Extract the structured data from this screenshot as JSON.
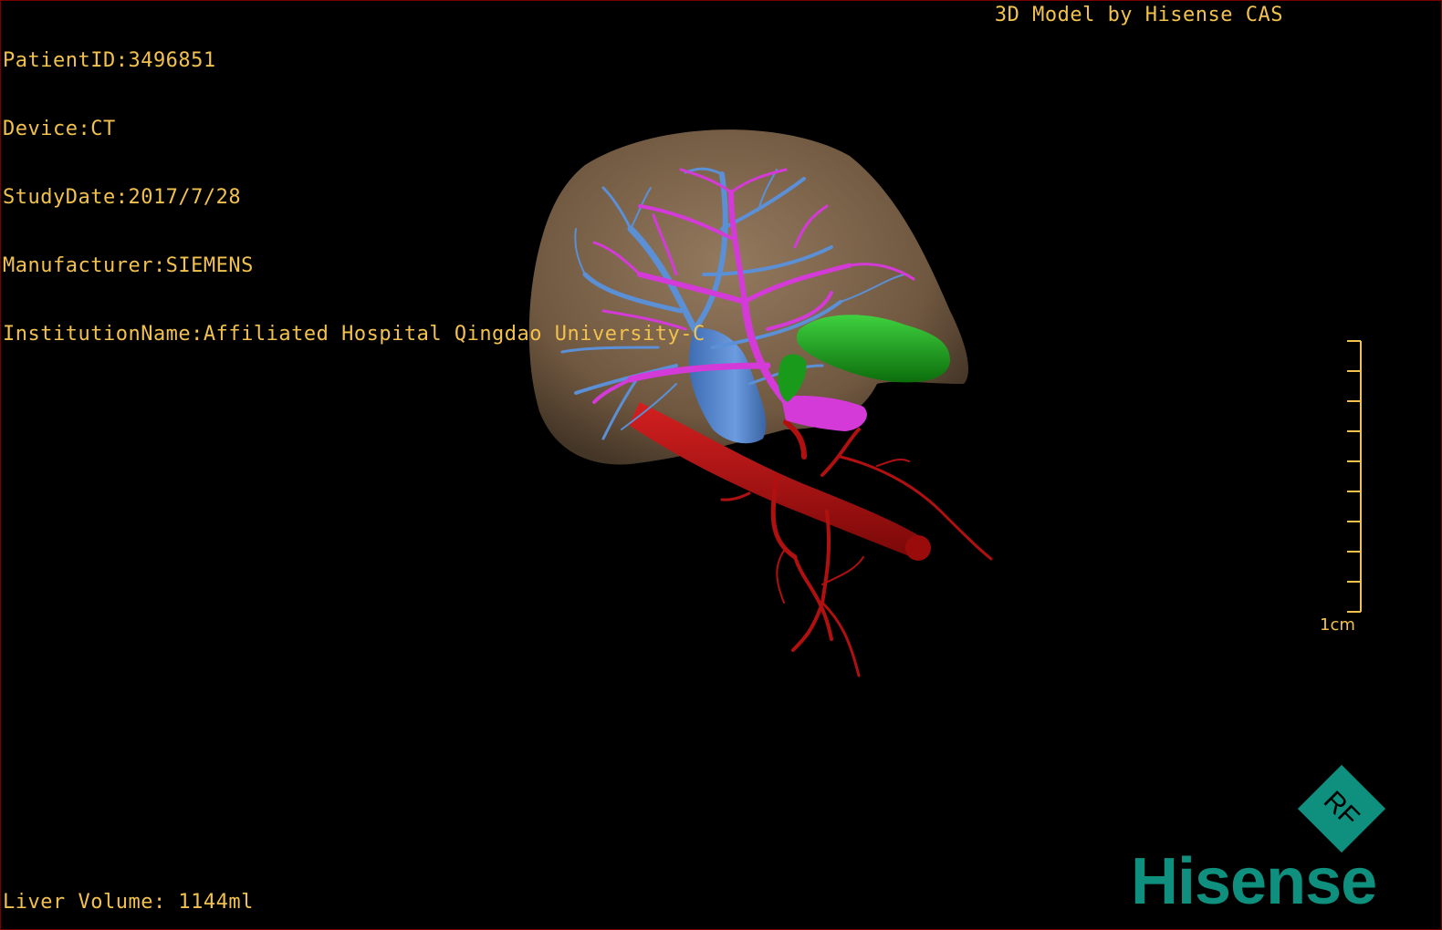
{
  "header": {
    "patient_id": "PatientID:3496851",
    "device": "Device:CT",
    "study_date": "StudyDate:2017/7/28",
    "manufacturer": "Manufacturer:SIEMENS",
    "institution": "InstitutionName:Affiliated Hospital Qingdao University-C",
    "brand_title": "3D Model by Hisense CAS"
  },
  "footer": {
    "liver_volume": "Liver Volume: 1144ml"
  },
  "scale_bar": {
    "label": "1cm"
  },
  "logo": {
    "rf_text": "RF",
    "brand_name": "Hisense"
  },
  "colors": {
    "overlay_text": "#f2c14e",
    "liver": "#8a6e4f",
    "portal_vein": "#d43ad8",
    "hepatic_vein": "#5b8fd6",
    "artery": "#b01010",
    "gallbladder": "#1a9a1a",
    "brand": "#0f8f7e"
  }
}
